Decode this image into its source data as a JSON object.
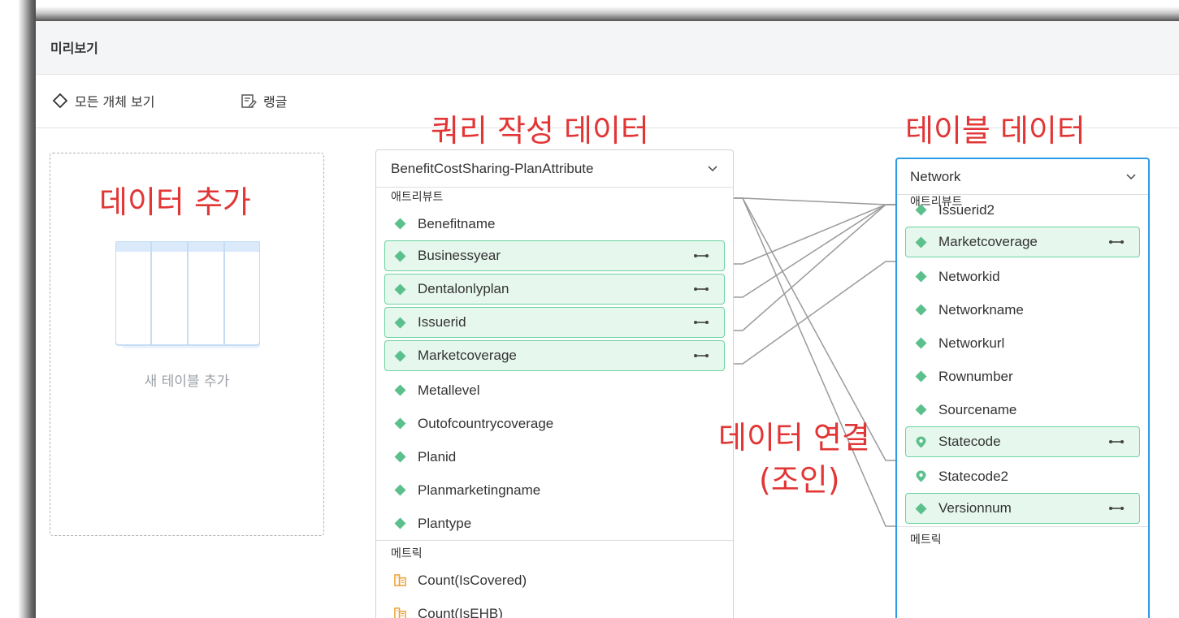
{
  "window": {
    "title": "미리보기"
  },
  "toolbar": {
    "show_all_label": "모든 개체 보기",
    "language_label": "랭글"
  },
  "add_table": {
    "label": "새 테이블 추가"
  },
  "left_table": {
    "name": "BenefitCostSharing-PlanAttribute",
    "attributes_section": "애트리뷰트",
    "attributes": [
      {
        "label": "Benefitname",
        "joined": false
      },
      {
        "label": "Businessyear",
        "joined": true
      },
      {
        "label": "Dentalonlyplan",
        "joined": true
      },
      {
        "label": "Issuerid",
        "joined": true
      },
      {
        "label": "Marketcoverage",
        "joined": true
      },
      {
        "label": "Metallevel",
        "joined": false
      },
      {
        "label": "Outofcountrycoverage",
        "joined": false
      },
      {
        "label": "Planid",
        "joined": false
      },
      {
        "label": "Planmarketingname",
        "joined": false
      },
      {
        "label": "Plantype",
        "joined": false
      }
    ],
    "metrics_section": "메트릭",
    "metrics": [
      "Count(IsCovered)",
      "Count(IsEHB)"
    ]
  },
  "right_table": {
    "name": "Network",
    "attributes_section": "애트리뷰트",
    "attributes": [
      {
        "label": "Issuerid2",
        "joined": false,
        "icon": "diamond-icon"
      },
      {
        "label": "Marketcoverage",
        "joined": true,
        "icon": "diamond-icon"
      },
      {
        "label": "Networkid",
        "joined": false,
        "icon": "diamond-icon"
      },
      {
        "label": "Networkname",
        "joined": false,
        "icon": "diamond-icon"
      },
      {
        "label": "Networkurl",
        "joined": false,
        "icon": "diamond-icon"
      },
      {
        "label": "Rownumber",
        "joined": false,
        "icon": "diamond-icon"
      },
      {
        "label": "Sourcename",
        "joined": false,
        "icon": "diamond-icon"
      },
      {
        "label": "Statecode",
        "joined": true,
        "icon": "location-pin-icon"
      },
      {
        "label": "Statecode2",
        "joined": false,
        "icon": "location-pin-icon"
      },
      {
        "label": "Versionnum",
        "joined": true,
        "icon": "diamond-icon"
      }
    ],
    "metrics_section": "메트릭"
  },
  "annotations": {
    "query_data": "쿼리 작성 데이터",
    "table_data": "테이블 데이터",
    "add_data": "데이터 추가",
    "join_line1": "데이터 연결",
    "join_line2": "(조인)"
  },
  "colors": {
    "annotation_red": "#e23636",
    "join_green_bg": "#e6f7ee",
    "join_green_border": "#6cd3a0",
    "diamond_green": "#5cc08c",
    "selected_blue": "#2a9be6",
    "metric_orange": "#f0a030"
  }
}
